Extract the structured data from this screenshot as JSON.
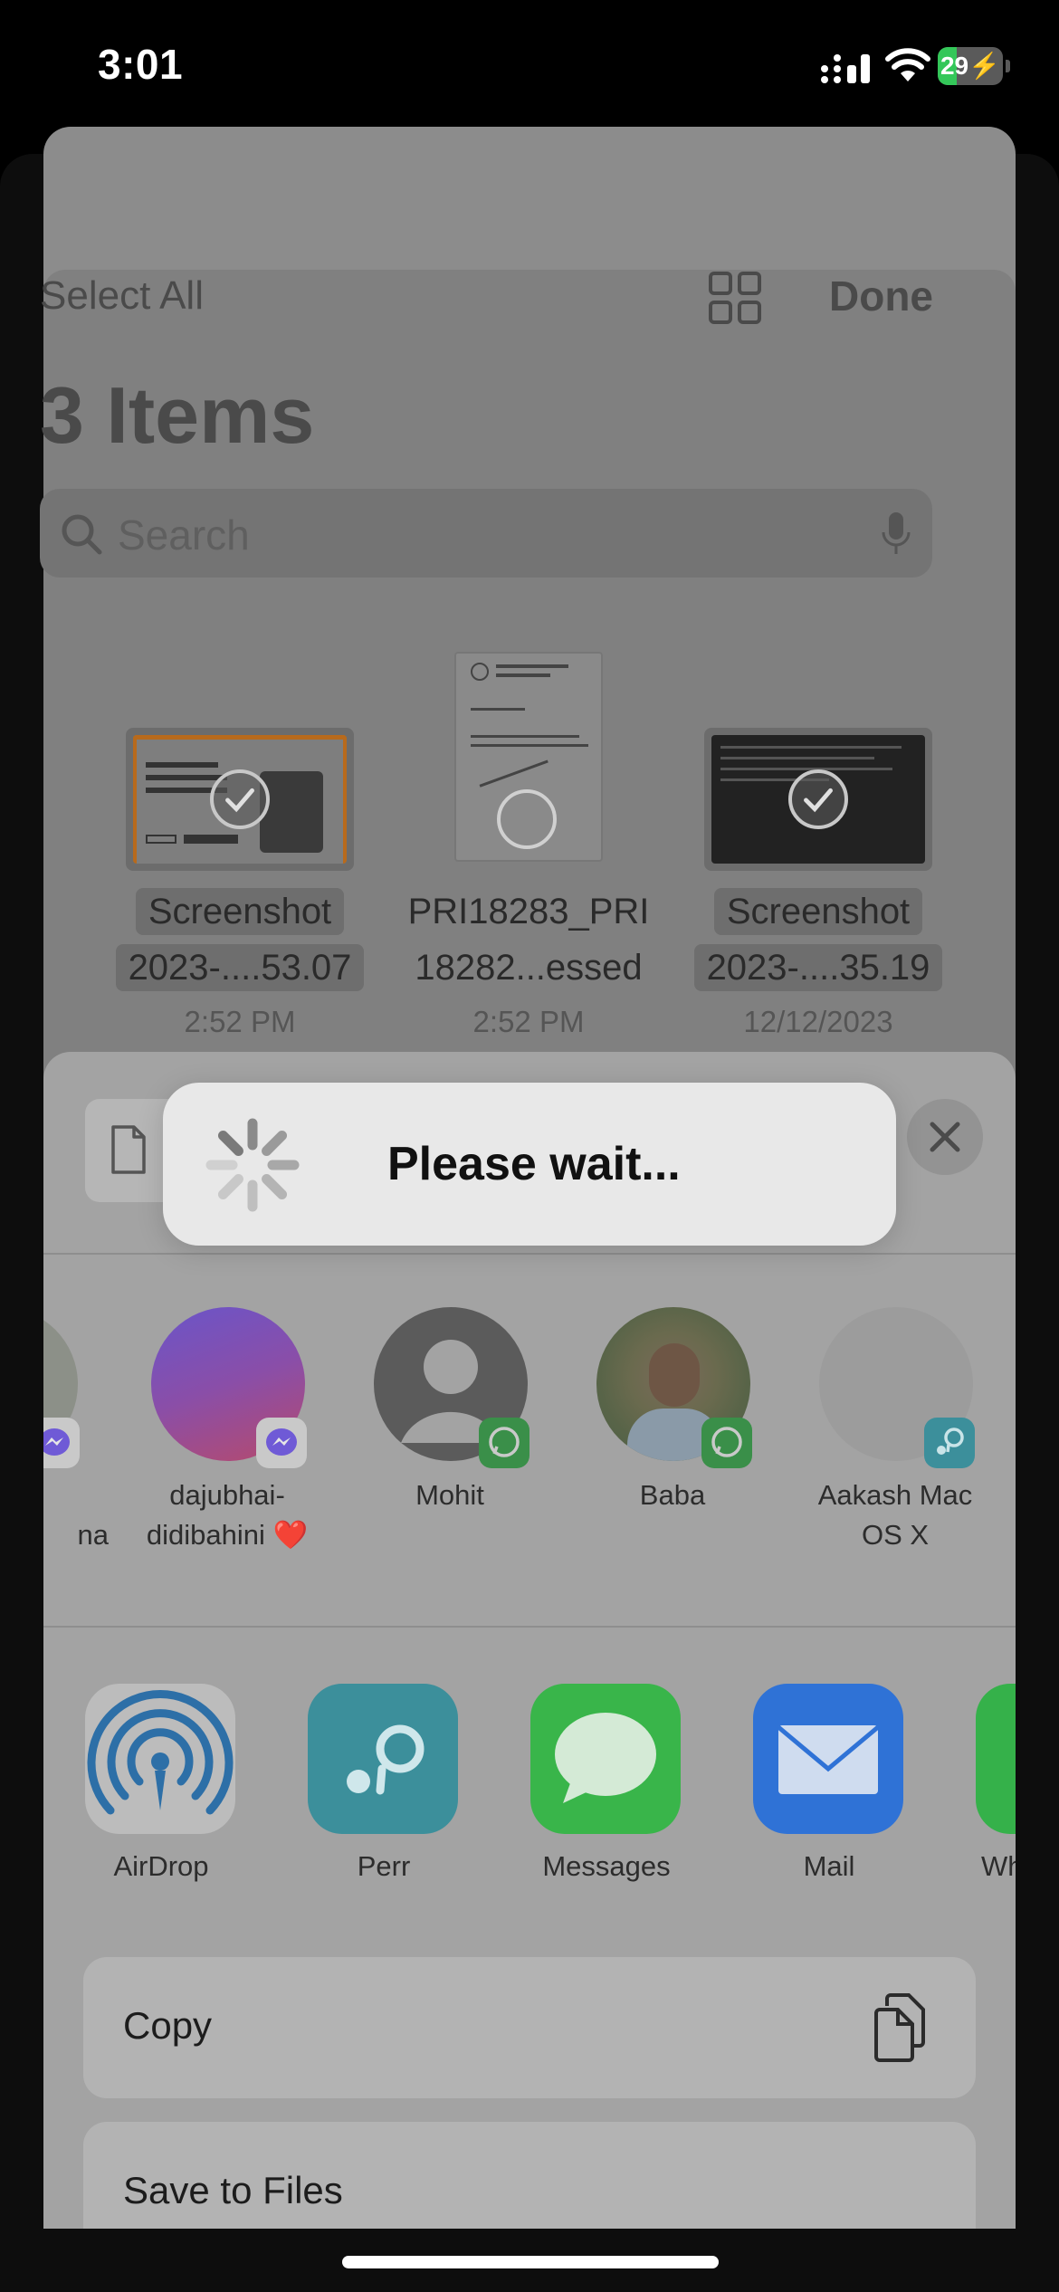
{
  "status_bar": {
    "time": "3:01",
    "battery": "29",
    "battery_level": 0.29,
    "battery_color": "#34c759"
  },
  "files_view": {
    "select_all": "Select All",
    "done": "Done",
    "title": "3 Items",
    "search_placeholder": "Search",
    "files": [
      {
        "name_line1": "Screenshot",
        "name_line2": "2023-....53.07",
        "date": "2:52 PM",
        "selected": true
      },
      {
        "name_line1": "PRI18283_PRI",
        "name_line2": "18282...essed",
        "date": "2:52 PM",
        "selected": false
      },
      {
        "name_line1": "Screenshot",
        "name_line2": "2023-....35.19",
        "date": "12/12/2023",
        "selected": true
      }
    ]
  },
  "share_sheet": {
    "people": [
      {
        "name_line1": "",
        "name_line2": "na",
        "badge": "messenger-icon"
      },
      {
        "name_line1": "dajubhai-",
        "name_line2": "didibahini ❤️",
        "badge": "messenger-icon"
      },
      {
        "name_line1": "Mohit",
        "name_line2": "",
        "badge": "whatsapp-icon"
      },
      {
        "name_line1": "Baba",
        "name_line2": "",
        "badge": "whatsapp-icon"
      },
      {
        "name_line1": "Aakash Mac",
        "name_line2": "OS X",
        "badge": "perr-icon"
      }
    ],
    "apps": [
      {
        "label": "AirDrop",
        "color": "#e1e1e1"
      },
      {
        "label": "Perr",
        "color": "#3c8f9b"
      },
      {
        "label": "Messages",
        "color": "#39b54a"
      },
      {
        "label": "Mail",
        "color": "#2f72d6"
      },
      {
        "label": "Wh",
        "color": "#35b14a"
      }
    ],
    "actions": [
      {
        "label": "Copy"
      },
      {
        "label": "Save to Files"
      }
    ]
  },
  "overlay": {
    "message": "Please wait..."
  }
}
